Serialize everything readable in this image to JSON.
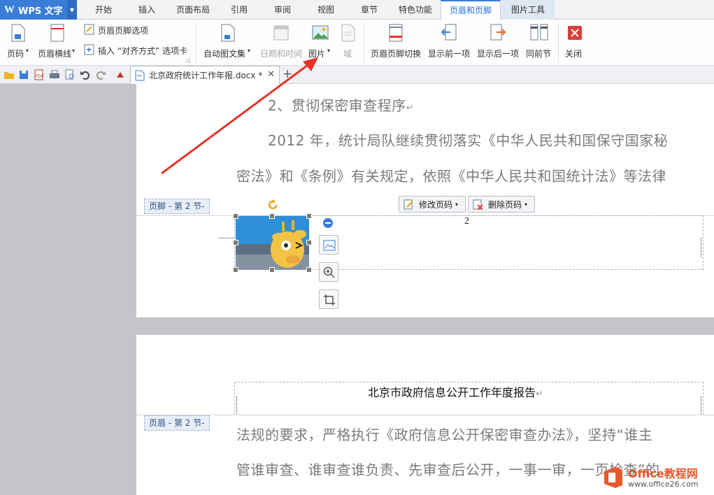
{
  "app": {
    "name": "WPS 文字"
  },
  "menu": {
    "tabs": [
      {
        "label": "开始"
      },
      {
        "label": "插入"
      },
      {
        "label": "页面布局"
      },
      {
        "label": "引用"
      },
      {
        "label": "审阅"
      },
      {
        "label": "视图"
      },
      {
        "label": "章节"
      },
      {
        "label": "特色功能"
      },
      {
        "label": "页眉和页脚",
        "active": true
      },
      {
        "label": "图片工具"
      }
    ]
  },
  "ribbon": {
    "page_number": "页码",
    "header_line": "页眉横线",
    "hf_options": "页眉页脚选项",
    "insert_align_tab": "插入 “对齐方式” 选项卡",
    "auto_text": "自动图文集",
    "date_time": "日期和时间",
    "picture": "图片",
    "field": "域",
    "hf_switch": "页眉页脚切换",
    "show_prev": "显示前一项",
    "show_next": "显示后一项",
    "same_as_prev": "同前节",
    "close": "关闭"
  },
  "document": {
    "tab_title": "北京政府统计工作年报.docx *"
  },
  "page1": {
    "line1": "2、贯彻保密审查程序",
    "line2": "2012 年，统计局队继续贯彻落实《中华人民共和国保守国家秘",
    "line3": "密法》和《条例》有关规定，依照《中华人民共和国统计法》等法律",
    "footer_tag": "页脚 - 第 2 节-",
    "edit_page_num": "修改页码",
    "delete_page_num": "删除页码",
    "page_number": "2"
  },
  "page2": {
    "header_title": "北京市政府信息公开工作年度报告",
    "header_tag": "页眉 - 第 2 节-",
    "line1": "法规的要求，严格执行《政府信息公开保密审查办法》，坚持“谁主",
    "line2": "管谁审查、谁审查谁负责、先审查后公开，一事一审，一页检查”的"
  },
  "watermark": {
    "brand": "Office教程网",
    "url": "www.office26.com"
  },
  "colors": {
    "accent": "#3a7dd6",
    "arrow": "#e8322b",
    "active_tab_text": "#2a6fd8"
  }
}
